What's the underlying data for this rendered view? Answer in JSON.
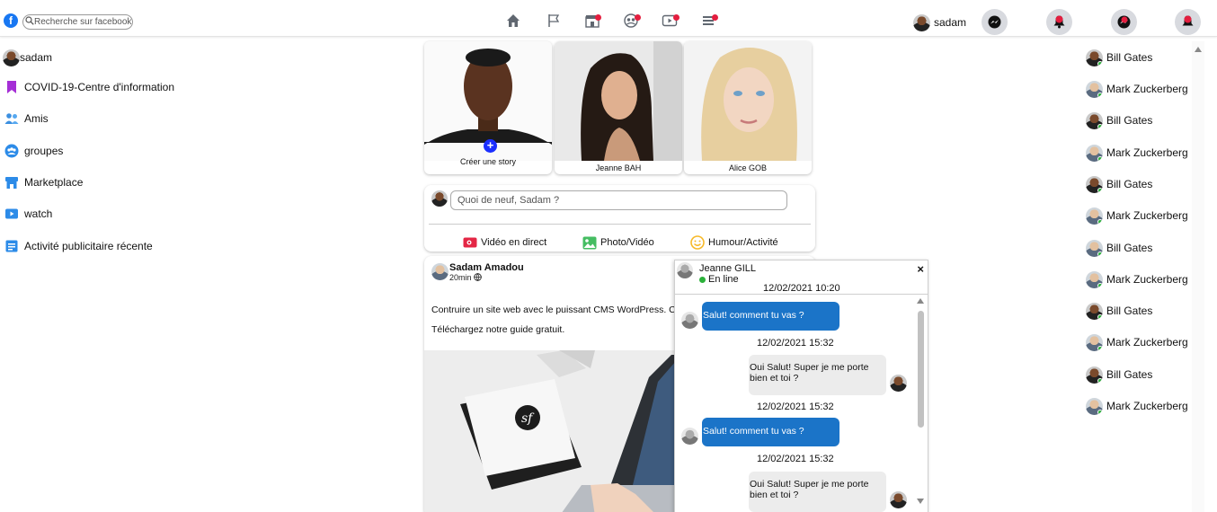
{
  "header": {
    "logo_letter": "f",
    "search_placeholder": "Recherche sur facebook",
    "user_name": "sadam",
    "nav_icons": [
      "home-icon",
      "flag-icon",
      "store-icon",
      "groups-icon",
      "video-icon",
      "menu-icon"
    ]
  },
  "sidebar": {
    "items": [
      {
        "label": "sadam",
        "icon": "user-avatar"
      },
      {
        "label": "COVID-19-Centre d'information",
        "icon": "bookmark-icon"
      },
      {
        "label": "Amis",
        "icon": "friends-icon"
      },
      {
        "label": "groupes",
        "icon": "groups-icon"
      },
      {
        "label": "Marketplace",
        "icon": "store-icon"
      },
      {
        "label": "watch",
        "icon": "play-icon"
      },
      {
        "label": "Activité publicitaire récente",
        "icon": "ads-icon"
      }
    ]
  },
  "stories": [
    {
      "caption": "Créer une story"
    },
    {
      "caption": "Jeanne BAH"
    },
    {
      "caption": "Alice GOB"
    }
  ],
  "composer": {
    "placeholder": "Quoi de neuf, Sadam ?",
    "actions": [
      "Vidéo en direct",
      "Photo/Vidéo",
      "Humour/Activité"
    ]
  },
  "post": {
    "author": "Sadam Amadou",
    "time": "20min",
    "text_line1": "Contruire un site web avec le puissant CMS WordPress. C",
    "text_line2": "Téléchargez notre guide gratuit."
  },
  "chat": {
    "contact": "Jeanne GILL",
    "status": "En line",
    "close": "×",
    "header_stamp": "12/02/2021 10:20",
    "messages": [
      {
        "text": "Salut! comment tu vas ?",
        "stamp": "12/02/2021 15:32"
      },
      {
        "text_line1": "Oui Salut! Super je me porte",
        "text_line2": "bien et toi ?",
        "stamp": "12/02/2021 15:32"
      },
      {
        "text": "Salut! comment tu vas ?",
        "stamp": "12/02/2021 15:32"
      },
      {
        "text_line1": "Oui Salut! Super je me porte",
        "text_line2": "bien et toi ?"
      }
    ]
  },
  "contacts": [
    "Bill Gates",
    "Mark Zuckerberg",
    "Bill Gates",
    "Mark Zuckerberg",
    "Bill Gates",
    "Mark Zuckerberg",
    "Bill Gates",
    "Mark Zuckerberg",
    "Bill Gates",
    "Mark Zuckerberg",
    "Bill Gates",
    "Mark Zuckerberg"
  ],
  "colors": {
    "brand": "#1877f2",
    "notification": "#e41e3f",
    "online": "#2bb13a",
    "bubble_in": "#1b74c8"
  }
}
